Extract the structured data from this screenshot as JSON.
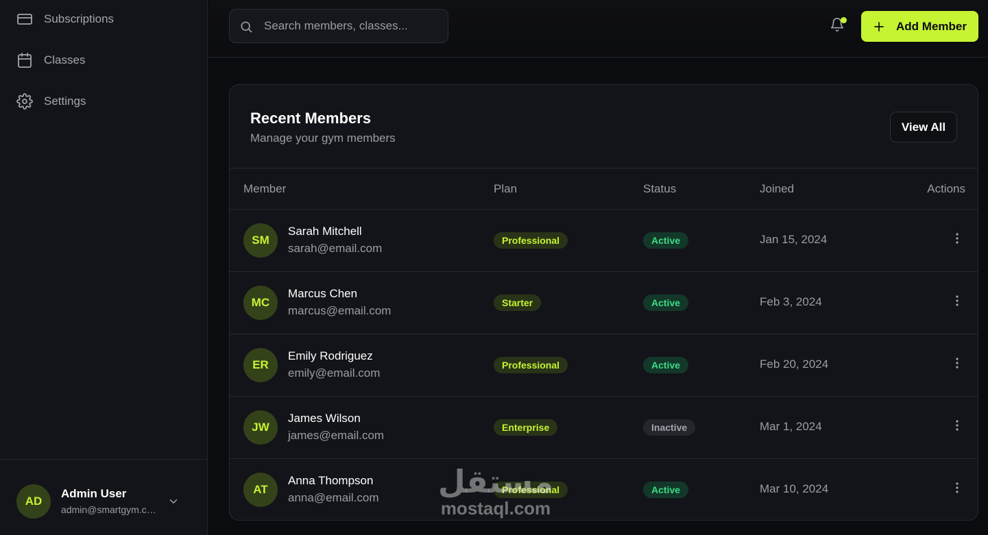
{
  "sidebar": {
    "nav": [
      {
        "label": "Subscriptions",
        "icon": "credit-card-icon"
      },
      {
        "label": "Classes",
        "icon": "calendar-icon"
      },
      {
        "label": "Settings",
        "icon": "gear-icon"
      }
    ],
    "user": {
      "initials": "AD",
      "name": "Admin User",
      "email": "admin@smartgym.com"
    }
  },
  "topbar": {
    "search_placeholder": "Search members, classes...",
    "add_button_label": "Add Member"
  },
  "members_card": {
    "title": "Recent Members",
    "subtitle": "Manage your gym members",
    "view_all_label": "View All",
    "columns": [
      "Member",
      "Plan",
      "Status",
      "Joined",
      "Actions"
    ],
    "rows": [
      {
        "initials": "SM",
        "name": "Sarah Mitchell",
        "email": "sarah@email.com",
        "plan": "Professional",
        "status": "Active",
        "joined": "Jan 15, 2024"
      },
      {
        "initials": "MC",
        "name": "Marcus Chen",
        "email": "marcus@email.com",
        "plan": "Starter",
        "status": "Active",
        "joined": "Feb 3, 2024"
      },
      {
        "initials": "ER",
        "name": "Emily Rodriguez",
        "email": "emily@email.com",
        "plan": "Professional",
        "status": "Active",
        "joined": "Feb 20, 2024"
      },
      {
        "initials": "JW",
        "name": "James Wilson",
        "email": "james@email.com",
        "plan": "Enterprise",
        "status": "Inactive",
        "joined": "Mar 1, 2024"
      },
      {
        "initials": "AT",
        "name": "Anna Thompson",
        "email": "anna@email.com",
        "plan": "Professional",
        "status": "Active",
        "joined": "Mar 10, 2024"
      }
    ]
  },
  "watermark": {
    "arabic": "مستقل",
    "latin": "mostaql.com"
  },
  "colors": {
    "accent": "#c6f432",
    "active": "#3ddc84",
    "background": "#0b0c0f",
    "panel": "#131419"
  }
}
